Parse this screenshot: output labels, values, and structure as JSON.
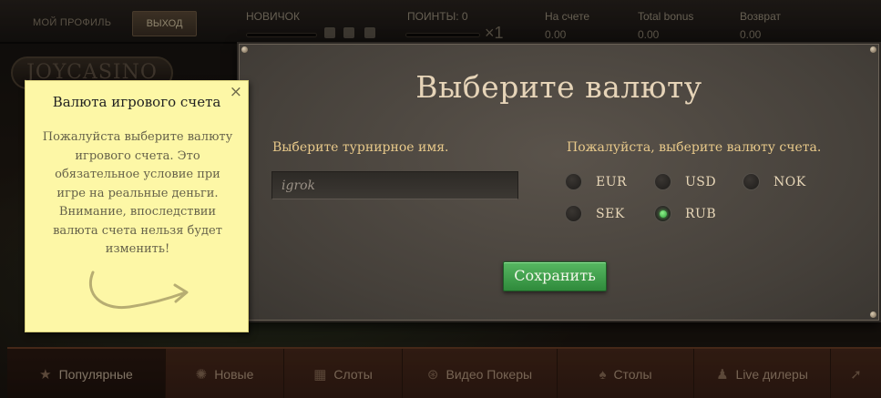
{
  "header": {
    "profile_label": "МОЙ ПРОФИЛЬ",
    "logout_label": "ВЫХОД",
    "level_label": "НОВИЧОК",
    "points_label": "ПОИНТЫ: 0",
    "multiplier": "×1",
    "balance_label": "На счете",
    "balance_value": "0.00",
    "bonus_label": "Total bonus",
    "bonus_value": "0.00",
    "refund_label": "Возврат",
    "refund_value": "0.00",
    "logo_text": "JOYCASINO"
  },
  "modal": {
    "title": "Выберите валюту",
    "name_label": "Выберите турнирное имя.",
    "name_value": "igrok",
    "currency_label": "Пожалуйста, выберите валюту счета.",
    "currencies": [
      {
        "code": "EUR",
        "checked": false
      },
      {
        "code": "USD",
        "checked": false
      },
      {
        "code": "NOK",
        "checked": false
      },
      {
        "code": "SEK",
        "checked": false
      },
      {
        "code": "RUB",
        "checked": true
      }
    ],
    "save_label": "Сохранить"
  },
  "tooltip": {
    "title": "Валюта игрового счета",
    "close": "×",
    "body": "Пожалуйста выберите валюту игрового счета. Это обязательное условие при игре на реальные деньги. Внимание, впоследствии валюта счета нельзя будет изменить!"
  },
  "nav": {
    "items": [
      {
        "label": "Популярные",
        "icon": "star-icon"
      },
      {
        "label": "Новые",
        "icon": "new-badge-icon"
      },
      {
        "label": "Слоты",
        "icon": "slot-machine-icon"
      },
      {
        "label": "Видео Покеры",
        "icon": "poker-chip-icon"
      },
      {
        "label": "Столы",
        "icon": "cards-icon"
      },
      {
        "label": "Live дилеры",
        "icon": "dealer-icon"
      }
    ]
  },
  "colors": {
    "accent_gold": "#e8c98a",
    "save_green": "#3f9c4a",
    "tooltip_yellow": "#fdf7a6",
    "radio_checked": "#4ccf52"
  }
}
